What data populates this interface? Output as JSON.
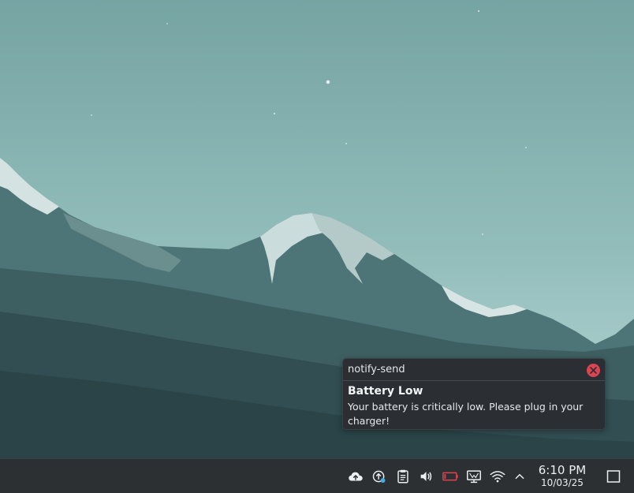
{
  "notification": {
    "app_name": "notify-send",
    "title": "Battery Low",
    "body": "Your battery is critically low. Please plug in your charger!",
    "close_icon": "close-icon"
  },
  "taskbar": {
    "tray_icons": [
      "cloud-upload-icon",
      "update-icon",
      "clipboard-icon",
      "volume-icon",
      "battery-low-icon",
      "display-icon",
      "wifi-icon",
      "chevron-up-icon"
    ],
    "clock": {
      "time": "6:10 PM",
      "date": "10/03/25"
    },
    "show_desktop_icon": "show-desktop-icon"
  },
  "colors": {
    "accent_close": "#da4453",
    "battery_warning": "#da4453",
    "panel": "#2c3033"
  }
}
